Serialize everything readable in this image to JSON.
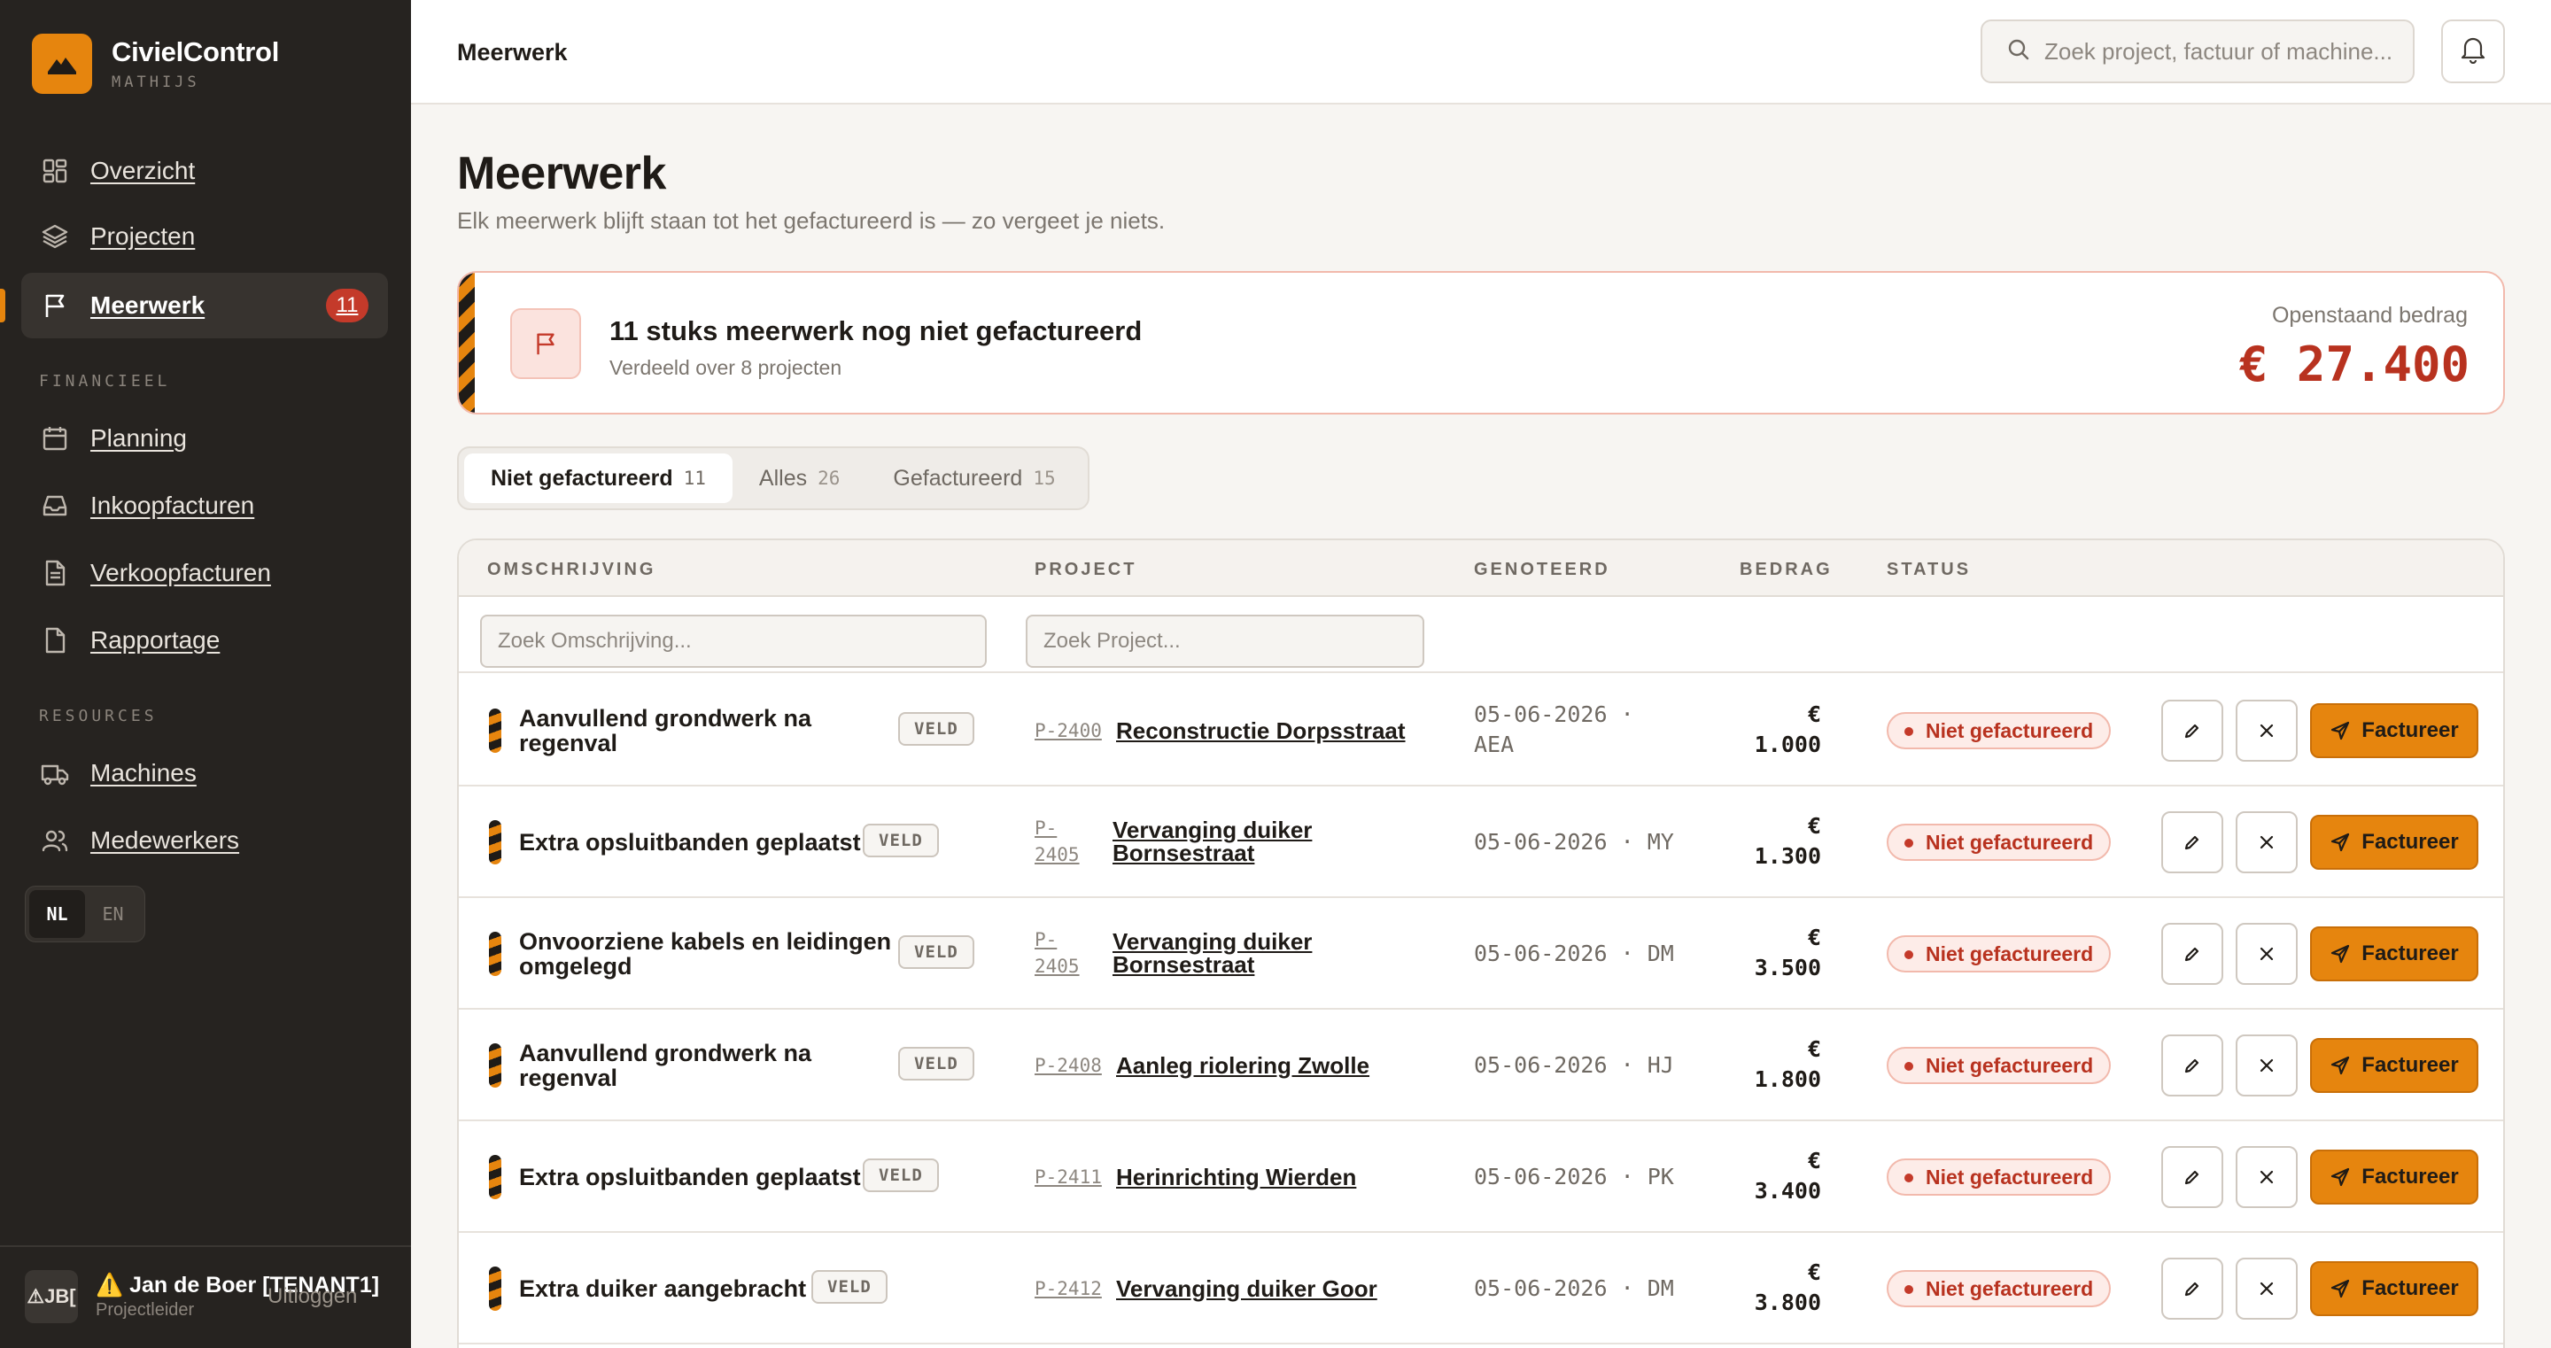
{
  "brand": {
    "name": "CivielControl",
    "tenant": "MATHIJS"
  },
  "nav": {
    "items": [
      {
        "label": "Overzicht",
        "icon": "grid-icon"
      },
      {
        "label": "Projecten",
        "icon": "layers-icon"
      },
      {
        "label": "Meerwerk",
        "icon": "flag-icon",
        "badge": "11",
        "active": true
      }
    ],
    "section_financieel": "FINANCIEEL",
    "financieel": [
      {
        "label": "Planning",
        "icon": "calendar-icon"
      },
      {
        "label": "Inkoopfacturen",
        "icon": "inbox-icon"
      },
      {
        "label": "Verkoopfacturen",
        "icon": "document-icon"
      },
      {
        "label": "Rapportage",
        "icon": "file-icon"
      }
    ],
    "section_resources": "RESOURCES",
    "resources": [
      {
        "label": "Machines",
        "icon": "truck-icon"
      },
      {
        "label": "Medewerkers",
        "icon": "users-icon"
      }
    ]
  },
  "lang": {
    "active": "NL",
    "other": "EN"
  },
  "user": {
    "avatar": "⚠JB[",
    "name": "⚠️ Jan de Boer [TENANT1]",
    "role": "Projectleider",
    "logout": "Uitloggen"
  },
  "topbar": {
    "title": "Meerwerk",
    "search_placeholder": "Zoek project, factuur of machine..."
  },
  "page": {
    "title": "Meerwerk",
    "subtitle": "Elk meerwerk blijft staan tot het gefactureerd is — zo vergeet je niets."
  },
  "summary": {
    "title": "11 stuks meerwerk nog niet gefactureerd",
    "subtitle": "Verdeeld over 8 projecten",
    "amount_label": "Openstaand bedrag",
    "amount": "€ 27.400"
  },
  "tabs": [
    {
      "label": "Niet gefactureerd",
      "count": "11",
      "active": true
    },
    {
      "label": "Alles",
      "count": "26"
    },
    {
      "label": "Gefactureerd",
      "count": "15"
    }
  ],
  "table": {
    "columns": {
      "omschrijving": "OMSCHRIJVING",
      "project": "PROJECT",
      "genoteerd": "GENOTEERD",
      "bedrag": "BEDRAG",
      "status": "STATUS"
    },
    "filter_desc_placeholder": "Zoek Omschrijving...",
    "filter_project_placeholder": "Zoek Project...",
    "rows": [
      {
        "desc1": "Aanvullend grondwerk na",
        "desc2": "regenval",
        "tag": "VELD",
        "code1": "P-2400",
        "code2": "",
        "project1": "Reconstructie Dorpsstraat",
        "project2": "",
        "date": "05-06-2026 ·",
        "initials": "AEA",
        "amount1": "€",
        "amount2": "1.000",
        "status": "Niet gefactureerd",
        "action": "Factureer"
      },
      {
        "desc1": "Extra opsluitbanden geplaatst",
        "desc2": "",
        "tag": "VELD",
        "code1": "P-",
        "code2": "2405",
        "project1": "Vervanging duiker",
        "project2": "Bornsestraat",
        "date": "05-06-2026 ·",
        "initials": "MY",
        "amount1": "€",
        "amount2": "1.300",
        "status": "Niet gefactureerd",
        "action": "Factureer"
      },
      {
        "desc1": "Onvoorziene kabels en leidingen",
        "desc2": "omgelegd",
        "tag": "VELD",
        "code1": "P-",
        "code2": "2405",
        "project1": "Vervanging duiker",
        "project2": "Bornsestraat",
        "date": "05-06-2026 ·",
        "initials": "DM",
        "amount1": "€",
        "amount2": "3.500",
        "status": "Niet gefactureerd",
        "action": "Factureer"
      },
      {
        "desc1": "Aanvullend grondwerk na",
        "desc2": "regenval",
        "tag": "VELD",
        "code1": "P-2408",
        "code2": "",
        "project1": "Aanleg riolering Zwolle",
        "project2": "",
        "date": "05-06-2026 ·",
        "initials": "HJ",
        "amount1": "€",
        "amount2": "1.800",
        "status": "Niet gefactureerd",
        "action": "Factureer"
      },
      {
        "desc1": "Extra opsluitbanden geplaatst",
        "desc2": "",
        "tag": "VELD",
        "code1": "P-2411",
        "code2": "",
        "project1": "Herinrichting Wierden",
        "project2": "",
        "date": "05-06-2026 ·",
        "initials": "PK",
        "amount1": "€",
        "amount2": "3.400",
        "status": "Niet gefactureerd",
        "action": "Factureer"
      },
      {
        "desc1": "Extra duiker aangebracht",
        "desc2": "",
        "tag": "VELD",
        "code1": "P-2412",
        "code2": "",
        "project1": "Vervanging duiker Goor",
        "project2": "",
        "date": "05-06-2026 ·",
        "initials": "DM",
        "amount1": "€",
        "amount2": "3.800",
        "status": "Niet gefactureerd",
        "action": "Factureer"
      }
    ]
  },
  "colors": {
    "accent": "#e6850e",
    "danger": "#b8321f",
    "sidebar": "#262320"
  }
}
